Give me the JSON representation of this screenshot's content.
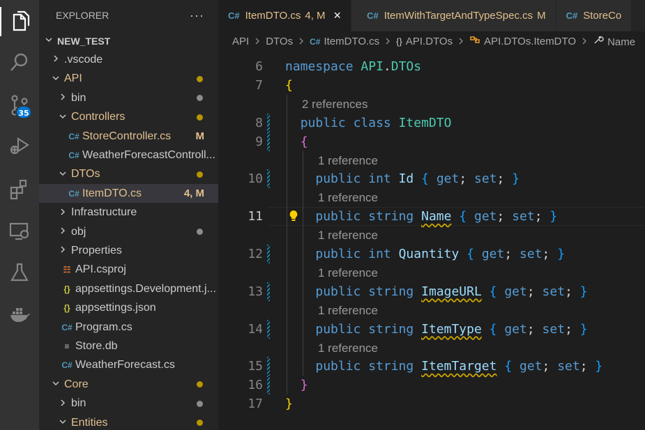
{
  "activity_bar": {
    "icons": [
      "explorer-icon",
      "search-icon",
      "source-control-icon",
      "run-debug-icon",
      "extensions-icon",
      "remote-explorer-icon",
      "testing-icon",
      "docker-icon"
    ],
    "source_control_badge": "35"
  },
  "sidebar": {
    "title": "EXPLORER",
    "more": "···",
    "tree": [
      {
        "label": "NEW_TEST",
        "chev": "v",
        "bold": true,
        "indent": 0
      },
      {
        "label": ".vscode",
        "chev": ">",
        "indent": 1
      },
      {
        "label": "API",
        "chev": "v",
        "indent": 1,
        "modified": true,
        "dot": "#b89500"
      },
      {
        "label": "bin",
        "chev": ">",
        "indent": 2,
        "dot": "#8c8c8c"
      },
      {
        "label": "Controllers",
        "chev": "v",
        "indent": 2,
        "modified": true,
        "dot": "#b89500"
      },
      {
        "label": "StoreController.cs",
        "indent": 3,
        "icon": "C#",
        "modified": true,
        "status": "M"
      },
      {
        "label": "WeatherForecastControll...",
        "indent": 3,
        "icon": "C#"
      },
      {
        "label": "DTOs",
        "chev": "v",
        "indent": 2,
        "modified": true,
        "dot": "#b89500"
      },
      {
        "label": "ItemDTO.cs",
        "indent": 3,
        "icon": "C#",
        "modified": true,
        "status": "4, M",
        "selected": true
      },
      {
        "label": "Infrastructure",
        "chev": ">",
        "indent": 2
      },
      {
        "label": "obj",
        "chev": ">",
        "indent": 2,
        "dot": "#8c8c8c"
      },
      {
        "label": "Properties",
        "chev": ">",
        "indent": 2
      },
      {
        "label": "API.csproj",
        "indent": 2,
        "icon": "rss"
      },
      {
        "label": "appsettings.Development.j...",
        "indent": 2,
        "icon": "{}"
      },
      {
        "label": "appsettings.json",
        "indent": 2,
        "icon": "{}"
      },
      {
        "label": "Program.cs",
        "indent": 2,
        "icon": "C#"
      },
      {
        "label": "Store.db",
        "indent": 2,
        "icon": "≡"
      },
      {
        "label": "WeatherForecast.cs",
        "indent": 2,
        "icon": "C#"
      },
      {
        "label": "Core",
        "chev": "v",
        "indent": 1,
        "modified": true,
        "dot": "#b89500"
      },
      {
        "label": "bin",
        "chev": ">",
        "indent": 2,
        "dot": "#8c8c8c"
      },
      {
        "label": "Entities",
        "chev": "v",
        "indent": 2,
        "modified": true,
        "dot": "#b89500"
      }
    ]
  },
  "tabs": [
    {
      "label": "ItemDTO.cs",
      "status": "4, M",
      "active": true,
      "close": "×"
    },
    {
      "label": "ItemWithTargetAndTypeSpec.cs",
      "status": "M"
    },
    {
      "label": "StoreCo",
      "status": ""
    }
  ],
  "breadcrumb": [
    {
      "label": "API"
    },
    {
      "label": "DTOs"
    },
    {
      "label": "ItemDTO.cs",
      "icon": "C#"
    },
    {
      "label": "API.DTOs",
      "icon": "{}"
    },
    {
      "label": "API.DTOs.ItemDTO",
      "icon": "class"
    },
    {
      "label": "Name",
      "icon": "wrench"
    }
  ],
  "editor": {
    "current_line": "11",
    "lines": [
      {
        "n": "6",
        "code": [
          [
            "kw",
            "namespace"
          ],
          [
            "",
            " "
          ],
          [
            "ty",
            "API"
          ],
          [
            "",
            "."
          ],
          [
            "ty",
            "DTOs"
          ]
        ]
      },
      {
        "n": "7",
        "code": [
          [
            "b1",
            "{"
          ]
        ]
      },
      {
        "lens": "2 references",
        "indent": 0
      },
      {
        "n": "8",
        "code": [
          [
            "",
            "  "
          ],
          [
            "kw",
            "public"
          ],
          [
            "",
            " "
          ],
          [
            "kw",
            "class"
          ],
          [
            "",
            " "
          ],
          [
            "ty",
            "ItemDTO"
          ]
        ],
        "gutter": true
      },
      {
        "n": "9",
        "code": [
          [
            "",
            "  "
          ],
          [
            "b2",
            "{"
          ]
        ],
        "gutter": true
      },
      {
        "lens": "1 reference",
        "indent": 1
      },
      {
        "n": "10",
        "code": [
          [
            "",
            "    "
          ],
          [
            "kw",
            "public"
          ],
          [
            "",
            " "
          ],
          [
            "kw",
            "int"
          ],
          [
            "",
            " "
          ],
          [
            "pr",
            "Id"
          ],
          [
            "",
            " "
          ],
          [
            "b3",
            "{"
          ],
          [
            "",
            " "
          ],
          [
            "kw",
            "get"
          ],
          [
            "",
            "; "
          ],
          [
            "kw",
            "set"
          ],
          [
            "",
            "; "
          ],
          [
            "b3",
            "}"
          ]
        ],
        "gutter": true
      },
      {
        "lens": "1 reference",
        "indent": 1
      },
      {
        "n": "11",
        "code": [
          [
            "",
            "    "
          ],
          [
            "kw",
            "public"
          ],
          [
            "",
            " "
          ],
          [
            "kw",
            "string"
          ],
          [
            "",
            " "
          ],
          [
            "pr sq",
            "Name"
          ],
          [
            "",
            " "
          ],
          [
            "b3",
            "{"
          ],
          [
            "",
            " "
          ],
          [
            "kw",
            "get"
          ],
          [
            "",
            "; "
          ],
          [
            "kw",
            "set"
          ],
          [
            "",
            "; "
          ],
          [
            "b3",
            "}"
          ]
        ],
        "bulb": true
      },
      {
        "lens": "1 reference",
        "indent": 1
      },
      {
        "n": "12",
        "code": [
          [
            "",
            "    "
          ],
          [
            "kw",
            "public"
          ],
          [
            "",
            " "
          ],
          [
            "kw",
            "int"
          ],
          [
            "",
            " "
          ],
          [
            "pr",
            "Quantity"
          ],
          [
            "",
            " "
          ],
          [
            "b3",
            "{"
          ],
          [
            "",
            " "
          ],
          [
            "kw",
            "get"
          ],
          [
            "",
            "; "
          ],
          [
            "kw",
            "set"
          ],
          [
            "",
            "; "
          ],
          [
            "b3",
            "}"
          ]
        ],
        "gutter": true
      },
      {
        "lens": "1 reference",
        "indent": 1
      },
      {
        "n": "13",
        "code": [
          [
            "",
            "    "
          ],
          [
            "kw",
            "public"
          ],
          [
            "",
            " "
          ],
          [
            "kw",
            "string"
          ],
          [
            "",
            " "
          ],
          [
            "pr sq",
            "ImageURL"
          ],
          [
            "",
            " "
          ],
          [
            "b3",
            "{"
          ],
          [
            "",
            " "
          ],
          [
            "kw",
            "get"
          ],
          [
            "",
            "; "
          ],
          [
            "kw",
            "set"
          ],
          [
            "",
            "; "
          ],
          [
            "b3",
            "}"
          ]
        ],
        "gutter": true
      },
      {
        "lens": "1 reference",
        "indent": 1
      },
      {
        "n": "14",
        "code": [
          [
            "",
            "    "
          ],
          [
            "kw",
            "public"
          ],
          [
            "",
            " "
          ],
          [
            "kw",
            "string"
          ],
          [
            "",
            " "
          ],
          [
            "pr sq",
            "ItemType"
          ],
          [
            "",
            " "
          ],
          [
            "b3",
            "{"
          ],
          [
            "",
            " "
          ],
          [
            "kw",
            "get"
          ],
          [
            "",
            "; "
          ],
          [
            "kw",
            "set"
          ],
          [
            "",
            "; "
          ],
          [
            "b3",
            "}"
          ]
        ],
        "gutter": true
      },
      {
        "lens": "1 reference",
        "indent": 1
      },
      {
        "n": "15",
        "code": [
          [
            "",
            "    "
          ],
          [
            "kw",
            "public"
          ],
          [
            "",
            " "
          ],
          [
            "kw",
            "string"
          ],
          [
            "",
            " "
          ],
          [
            "pr sq",
            "ItemTarget"
          ],
          [
            "",
            " "
          ],
          [
            "b3",
            "{"
          ],
          [
            "",
            " "
          ],
          [
            "kw",
            "get"
          ],
          [
            "",
            "; "
          ],
          [
            "kw",
            "set"
          ],
          [
            "",
            "; "
          ],
          [
            "b3",
            "}"
          ]
        ],
        "gutter": true
      },
      {
        "n": "16",
        "code": [
          [
            "",
            "  "
          ],
          [
            "b2",
            "}"
          ]
        ],
        "gutter": true
      },
      {
        "n": "17",
        "code": [
          [
            "b1",
            "}"
          ]
        ]
      }
    ]
  },
  "colors": {
    "modified": "#e2c08d",
    "csharp_icon": "#519aba",
    "keyword": "#569cd6",
    "type": "#4ec9b0",
    "property": "#9cdcfe",
    "accent": "#0078d4"
  }
}
